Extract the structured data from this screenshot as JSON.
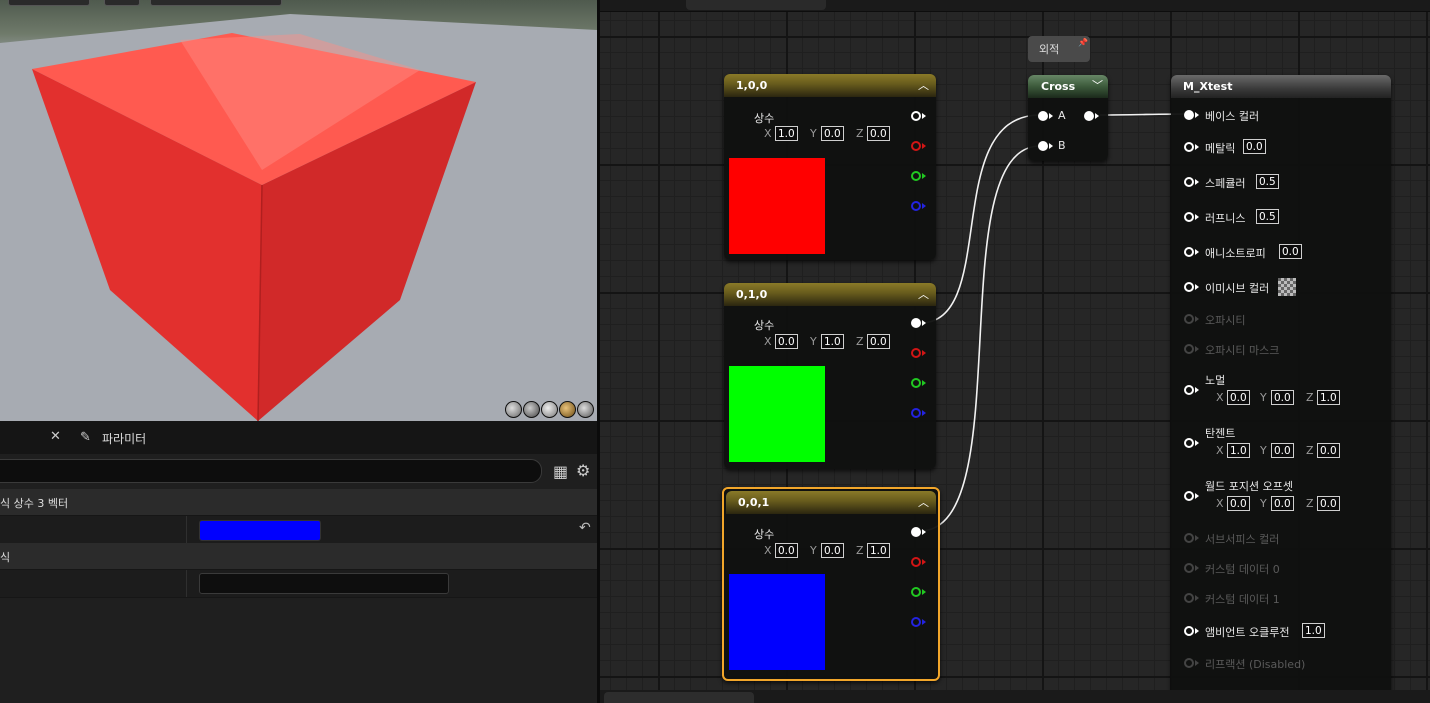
{
  "details": {
    "params_tab": "파라미터",
    "category1": "식 상수 3 벡터",
    "category2": "식",
    "constant_color": "#0000ff"
  },
  "nodes": {
    "c1": {
      "title": "1,0,0",
      "label": "상수",
      "x": "1.0",
      "y": "0.0",
      "z": "0.0",
      "color": "#ff0000"
    },
    "c2": {
      "title": "0,1,0",
      "label": "상수",
      "x": "0.0",
      "y": "1.0",
      "z": "0.0",
      "color": "#00ff00"
    },
    "c3": {
      "title": "0,0,1",
      "label": "상수",
      "x": "0.0",
      "y": "0.0",
      "z": "1.0",
      "color": "#0000ff"
    },
    "axis": {
      "x": "X",
      "y": "Y",
      "z": "Z"
    },
    "comment": "외적",
    "cross": {
      "title": "Cross",
      "a": "A",
      "b": "B"
    },
    "material": {
      "title": "M_Xtest",
      "base_color": "베이스 컬러",
      "metallic": "메탈릭",
      "metallic_val": "0.0",
      "specular": "스페큘러",
      "specular_val": "0.5",
      "roughness": "러프니스",
      "roughness_val": "0.5",
      "anisotropy": "애니소트로피",
      "anisotropy_val": "0.0",
      "emissive": "이미시브 컬러",
      "opacity": "오파시티",
      "opacity_mask": "오파시티 마스크",
      "normal": "노멀",
      "normal_x": "0.0",
      "normal_y": "0.0",
      "normal_z": "1.0",
      "tangent": "탄젠트",
      "tangent_x": "1.0",
      "tangent_y": "0.0",
      "tangent_z": "0.0",
      "wpo": "월드 포지션 오프셋",
      "wpo_x": "0.0",
      "wpo_y": "0.0",
      "wpo_z": "0.0",
      "subsurface": "서브서피스 컬러",
      "custom0": "커스텀 데이터 0",
      "custom1": "커스텀 데이터 1",
      "ao": "앰비언트 오클루전",
      "ao_val": "1.0",
      "refraction": "리프랙션 (Disabled)"
    }
  }
}
